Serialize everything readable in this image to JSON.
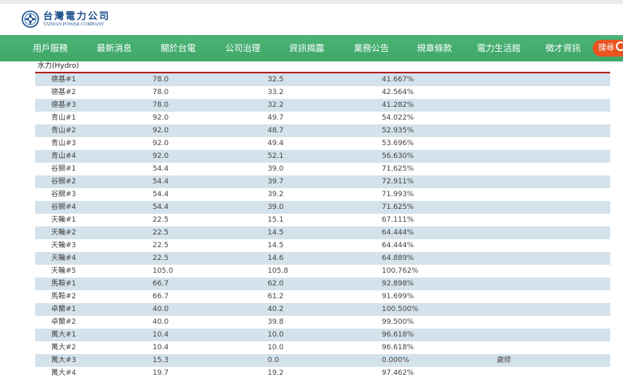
{
  "header": {
    "logo_cn": "台灣電力公司",
    "logo_en": "TAIWAN POWER COMPANY"
  },
  "nav": {
    "items": [
      "用戶服務",
      "最新消息",
      "關於台電",
      "公司治理",
      "資訊揭露",
      "業務公告",
      "規章條款",
      "電力生活館",
      "徵才資訊"
    ],
    "search_label": "搜尋"
  },
  "colors": {
    "nav_green": "#3ea869",
    "search_orange": "#e8531f",
    "row_stripe": "#d4e2ec",
    "section_rule": "#b22222"
  },
  "section": {
    "title": "水力(Hydro)"
  },
  "table": {
    "rows": [
      {
        "unit": "德基#1",
        "capacity": "78.0",
        "output": "32.5",
        "ratio": "41.667%",
        "note": ""
      },
      {
        "unit": "德基#2",
        "capacity": "78.0",
        "output": "33.2",
        "ratio": "42.564%",
        "note": ""
      },
      {
        "unit": "德基#3",
        "capacity": "78.0",
        "output": "32.2",
        "ratio": "41.282%",
        "note": ""
      },
      {
        "unit": "青山#1",
        "capacity": "92.0",
        "output": "49.7",
        "ratio": "54.022%",
        "note": ""
      },
      {
        "unit": "青山#2",
        "capacity": "92.0",
        "output": "48.7",
        "ratio": "52.935%",
        "note": ""
      },
      {
        "unit": "青山#3",
        "capacity": "92.0",
        "output": "49.4",
        "ratio": "53.696%",
        "note": ""
      },
      {
        "unit": "青山#4",
        "capacity": "92.0",
        "output": "52.1",
        "ratio": "56.630%",
        "note": ""
      },
      {
        "unit": "谷關#1",
        "capacity": "54.4",
        "output": "39.0",
        "ratio": "71.625%",
        "note": ""
      },
      {
        "unit": "谷關#2",
        "capacity": "54.4",
        "output": "39.7",
        "ratio": "72.911%",
        "note": ""
      },
      {
        "unit": "谷關#3",
        "capacity": "54.4",
        "output": "39.2",
        "ratio": "71.993%",
        "note": ""
      },
      {
        "unit": "谷關#4",
        "capacity": "54.4",
        "output": "39.0",
        "ratio": "71.625%",
        "note": ""
      },
      {
        "unit": "天輪#1",
        "capacity": "22.5",
        "output": "15.1",
        "ratio": "67.111%",
        "note": ""
      },
      {
        "unit": "天輪#2",
        "capacity": "22.5",
        "output": "14.5",
        "ratio": "64.444%",
        "note": ""
      },
      {
        "unit": "天輪#3",
        "capacity": "22.5",
        "output": "14.5",
        "ratio": "64.444%",
        "note": ""
      },
      {
        "unit": "天輪#4",
        "capacity": "22.5",
        "output": "14.6",
        "ratio": "64.889%",
        "note": ""
      },
      {
        "unit": "天輪#5",
        "capacity": "105.0",
        "output": "105.8",
        "ratio": "100.762%",
        "note": ""
      },
      {
        "unit": "馬鞍#1",
        "capacity": "66.7",
        "output": "62.0",
        "ratio": "92.898%",
        "note": ""
      },
      {
        "unit": "馬鞍#2",
        "capacity": "66.7",
        "output": "61.2",
        "ratio": "91.699%",
        "note": ""
      },
      {
        "unit": "卓蘭#1",
        "capacity": "40.0",
        "output": "40.2",
        "ratio": "100.500%",
        "note": ""
      },
      {
        "unit": "卓蘭#2",
        "capacity": "40.0",
        "output": "39.8",
        "ratio": "99.500%",
        "note": ""
      },
      {
        "unit": "萬大#1",
        "capacity": "10.4",
        "output": "10.0",
        "ratio": "96.618%",
        "note": ""
      },
      {
        "unit": "萬大#2",
        "capacity": "10.4",
        "output": "10.0",
        "ratio": "96.618%",
        "note": ""
      },
      {
        "unit": "萬大#3",
        "capacity": "15.3",
        "output": "0.0",
        "ratio": "0.000%",
        "note": "歲修"
      },
      {
        "unit": "萬大#4",
        "capacity": "19.7",
        "output": "19.2",
        "ratio": "97.462%",
        "note": ""
      }
    ]
  }
}
